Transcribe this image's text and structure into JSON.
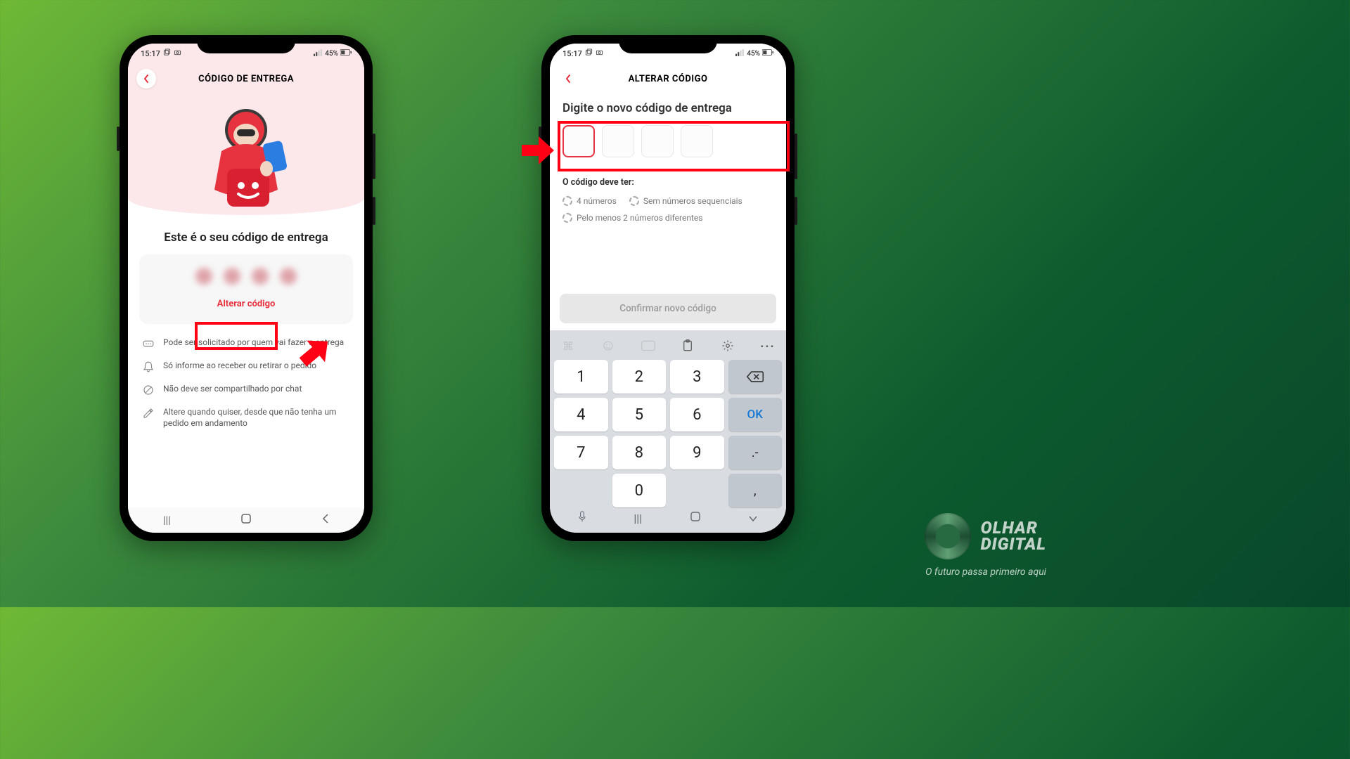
{
  "status": {
    "time": "15:17",
    "battery": "45%"
  },
  "phone1": {
    "header_title": "CÓDIGO DE ENTREGA",
    "main_title": "Este é o seu código de entrega",
    "alterar_label": "Alterar código",
    "info": [
      "Pode ser solicitado por quem vai fazer a entrega",
      "Só informe ao receber ou retirar o pedido",
      "Não deve ser compartilhado por chat",
      "Altere quando quiser, desde que não tenha um pedido em andamento"
    ]
  },
  "phone2": {
    "header_title": "ALTERAR CÓDIGO",
    "main_title": "Digite o novo código de entrega",
    "rules_title": "O código deve ter:",
    "rules": [
      "4 números",
      "Sem números sequenciais",
      "Pelo menos 2 números diferentes"
    ],
    "confirm_label": "Confirmar novo código",
    "ok_label": "OK",
    "punct1": ".-",
    "punct2": ",",
    "keys": [
      "1",
      "2",
      "3",
      "4",
      "5",
      "6",
      "7",
      "8",
      "9",
      "0"
    ]
  },
  "brand": {
    "line1": "OLHAR",
    "line2": "DIGITAL",
    "tagline": "O futuro passa primeiro aqui"
  }
}
